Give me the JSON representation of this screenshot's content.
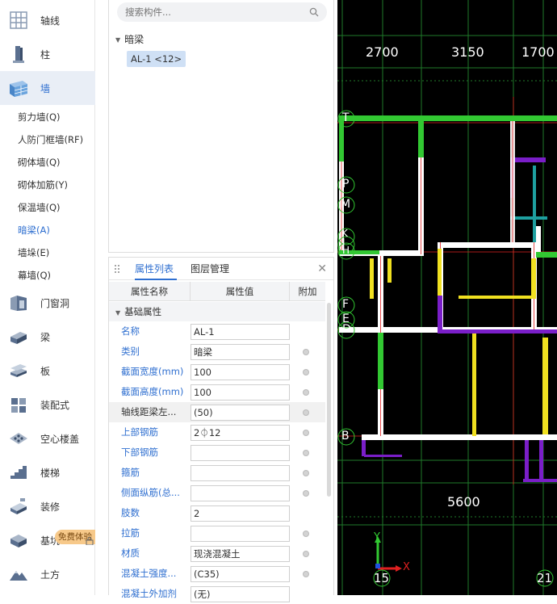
{
  "nav": {
    "items": [
      {
        "label": "轴线",
        "icon": "axis-grid-icon"
      },
      {
        "label": "柱",
        "icon": "column-icon"
      },
      {
        "label": "墙",
        "icon": "wall-icon",
        "active": true
      },
      {
        "label": "门窗洞",
        "icon": "door-window-icon"
      },
      {
        "label": "梁",
        "icon": "beam-icon"
      },
      {
        "label": "板",
        "icon": "slab-icon"
      },
      {
        "label": "装配式",
        "icon": "prefab-icon"
      },
      {
        "label": "空心楼盖",
        "icon": "hollow-floor-icon"
      },
      {
        "label": "楼梯",
        "icon": "stair-icon"
      },
      {
        "label": "装修",
        "icon": "decoration-icon"
      },
      {
        "label": "基坑",
        "icon": "foundation-pit-icon"
      },
      {
        "label": "土方",
        "icon": "earthwork-icon"
      }
    ],
    "wall_sub_items": [
      {
        "label": "剪力墙(Q)"
      },
      {
        "label": "人防门框墙(RF)"
      },
      {
        "label": "砌体墙(Q)"
      },
      {
        "label": "砌体加筋(Y)"
      },
      {
        "label": "保温墙(Q)"
      },
      {
        "label": "暗梁(A)",
        "active": true
      },
      {
        "label": "墙垛(E)"
      },
      {
        "label": "幕墙(Q)"
      }
    ],
    "trial_badge": "免费体验"
  },
  "component_list": {
    "search_placeholder": "搜索构件...",
    "group_label": "暗梁",
    "selected_item": "AL-1 <12>"
  },
  "properties": {
    "tabs": [
      {
        "label": "属性列表",
        "active": true
      },
      {
        "label": "图层管理"
      }
    ],
    "columns": {
      "name": "属性名称",
      "value": "属性值",
      "extra": "附加"
    },
    "section_label": "基础属性",
    "rows": [
      {
        "name": "名称",
        "value": "AL-1",
        "dot": false
      },
      {
        "name": "类别",
        "value": "暗梁",
        "dot": true
      },
      {
        "name": "截面宽度(mm)",
        "value": "100",
        "dot": true
      },
      {
        "name": "截面高度(mm)",
        "value": "100",
        "dot": true
      },
      {
        "name": "轴线距梁左...",
        "value": "(50)",
        "dot": true,
        "dark": true
      },
      {
        "name": "上部钢筋",
        "value": "2⏀12",
        "dot": true
      },
      {
        "name": "下部钢筋",
        "value": "",
        "dot": true
      },
      {
        "name": "箍筋",
        "value": "",
        "dot": true
      },
      {
        "name": "侧面纵筋(总...",
        "value": "",
        "dot": true
      },
      {
        "name": "肢数",
        "value": "2",
        "dot": false
      },
      {
        "name": "拉筋",
        "value": "",
        "dot": true
      },
      {
        "name": "材质",
        "value": "现浇混凝土",
        "dot": true
      },
      {
        "name": "混凝土强度...",
        "value": "(C35)",
        "dot": true
      },
      {
        "name": "混凝土外加剂",
        "value": "(无)",
        "dot": false
      }
    ]
  },
  "cad": {
    "top_dims": [
      "2700",
      "3150",
      "1700"
    ],
    "bottom_dim": "5600",
    "axis_labels_left": [
      "T",
      "P",
      "M",
      "K",
      "J",
      "H",
      "F",
      "E",
      "D",
      "B"
    ],
    "axis_labels_bottom": [
      "15",
      "21"
    ],
    "ucs_x": "X",
    "ucs_y": "Y",
    "colors": {
      "background": "#000000",
      "grid": "#1f7a2a",
      "green_wall": "#32c832",
      "yellow_beam": "#f0e020",
      "purple": "#7a1ec8",
      "cyan": "#1ea0a0",
      "white": "#ffffff",
      "red": "#e02020"
    }
  }
}
